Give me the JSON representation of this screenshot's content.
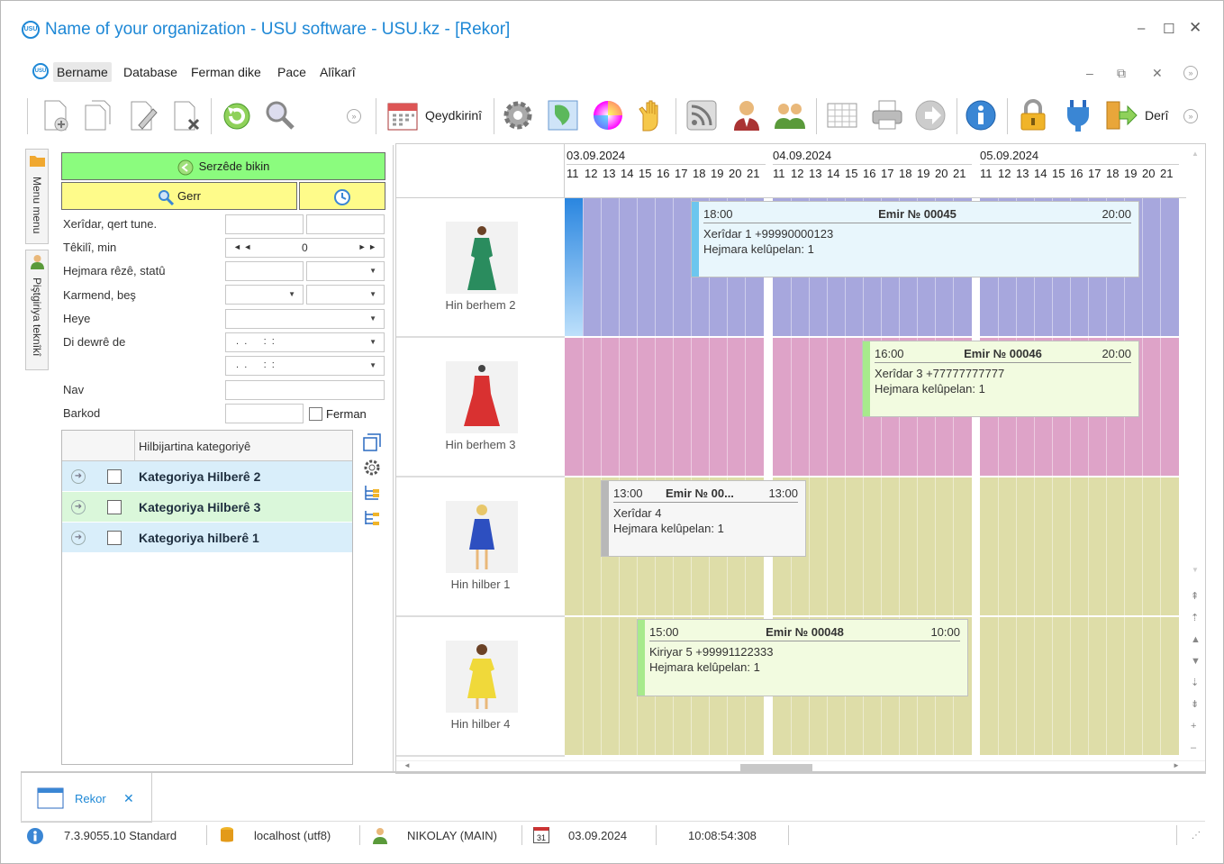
{
  "window": {
    "title": "Name of your organization - USU software - USU.kz - [Rekor]",
    "logo_text": "USU"
  },
  "menu": {
    "items": [
      "Bername",
      "Database",
      "Ferman dike",
      "Pace",
      "Alîkarî"
    ]
  },
  "toolbar": {
    "schedule_label": "Qeydkirinî",
    "exit_label": "Derî"
  },
  "side_tabs": {
    "menu": "Menu menu",
    "support": "Piştgiriya teknîkî"
  },
  "filter": {
    "search_button": "Serzêde bikin",
    "find_button": "Gerr",
    "fields": [
      {
        "label": "Xerîdar, qert tune."
      },
      {
        "label": "Têkilî, min",
        "value": "0"
      },
      {
        "label": "Hejmara rêzê, statû"
      },
      {
        "label": "Karmend, beş"
      },
      {
        "label": "Heye"
      },
      {
        "label": "Di dewrê de",
        "value": " .  .      :  :"
      },
      {
        "label": "Nav"
      },
      {
        "label": "Barkod"
      }
    ],
    "order_checkbox_label": "Ferman"
  },
  "categories": {
    "header": "Hilbijartina kategoriyê",
    "rows": [
      {
        "label": "Kategoriya Hilberê 2",
        "color": "#d9eefa"
      },
      {
        "label": "Kategoriya Hilberê 3",
        "color": "#daf7da"
      },
      {
        "label": "Kategoriya hilberê 1",
        "color": "#d9eefa"
      }
    ]
  },
  "schedule": {
    "dates": [
      "03.09.2024",
      "04.09.2024",
      "05.09.2024"
    ],
    "hours": [
      "11",
      "12",
      "13",
      "14",
      "15",
      "16",
      "17",
      "18",
      "19",
      "20",
      "21"
    ],
    "resources": [
      {
        "name": "Hin berhem 2",
        "color": "#a7a7dd",
        "dress": "#2a8c5e"
      },
      {
        "name": "Hin berhem 3",
        "color": "#dea3c8",
        "dress": "#d93131"
      },
      {
        "name": "Hin hilber 1",
        "color": "#dedda8",
        "dress": "#2d4fc0"
      },
      {
        "name": "Hin hilber 4",
        "color": "#dedda8",
        "dress": "#f0d93a"
      }
    ],
    "appointments": [
      {
        "start": "18:00",
        "title": "Emir № 00045",
        "end": "20:00",
        "line1": "Xerîdar 1 +99990000123",
        "line2": "Hejmara kelûpelan: 1",
        "bar": "#6cc6ee",
        "bg": "#e8f6fc"
      },
      {
        "start": "16:00",
        "title": "Emir № 00046",
        "end": "20:00",
        "line1": "Xerîdar 3 +77777777777",
        "line2": "Hejmara kelûpelan: 1",
        "bar": "#a7ea8c",
        "bg": "#f2fbe0"
      },
      {
        "start": "13:00",
        "title": "Emir № 00...",
        "end": "13:00",
        "line1": "Xerîdar 4",
        "line2": "Hejmara kelûpelan: 1",
        "bar": "#b8b8b8",
        "bg": "#f6f6f6"
      },
      {
        "start": "15:00",
        "title": "Emir № 00048",
        "end": "10:00",
        "line1": "Kiriyar 5 +99991122333",
        "line2": "Hejmara kelûpelan: 1",
        "bar": "#a7ea8c",
        "bg": "#f2fbe0"
      }
    ]
  },
  "tabs": [
    {
      "label": "Rekor"
    }
  ],
  "status": {
    "version": "7.3.9055.10 Standard",
    "server": "localhost (utf8)",
    "user": "NIKOLAY (MAIN)",
    "calendar_day": "31",
    "date": "03.09.2024",
    "time": "10:08:54:308"
  }
}
